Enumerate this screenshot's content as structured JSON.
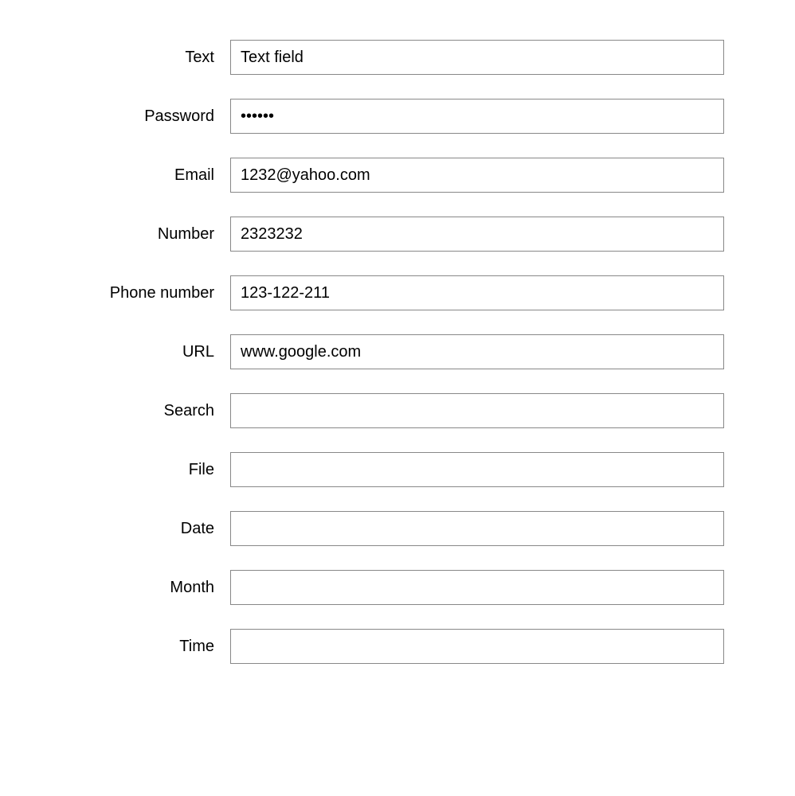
{
  "form": {
    "fields": [
      {
        "label": "Text",
        "type": "text",
        "value": "Text field",
        "name": "text-input"
      },
      {
        "label": "Password",
        "type": "password",
        "value": "••••••",
        "name": "password-input"
      },
      {
        "label": "Email",
        "type": "text",
        "value": "1232@yahoo.com",
        "name": "email-input"
      },
      {
        "label": "Number",
        "type": "text",
        "value": "2323232",
        "name": "number-input"
      },
      {
        "label": "Phone number",
        "type": "text",
        "value": "123-122-211",
        "name": "phone-input"
      },
      {
        "label": "URL",
        "type": "text",
        "value": "www.google.com",
        "name": "url-input"
      },
      {
        "label": "Search",
        "type": "text",
        "value": "",
        "name": "search-input"
      },
      {
        "label": "File",
        "type": "text",
        "value": "",
        "name": "file-input"
      },
      {
        "label": "Date",
        "type": "text",
        "value": "",
        "name": "date-input"
      },
      {
        "label": "Month",
        "type": "text",
        "value": "",
        "name": "month-input"
      },
      {
        "label": "Time",
        "type": "text",
        "value": "",
        "name": "time-input"
      }
    ]
  }
}
